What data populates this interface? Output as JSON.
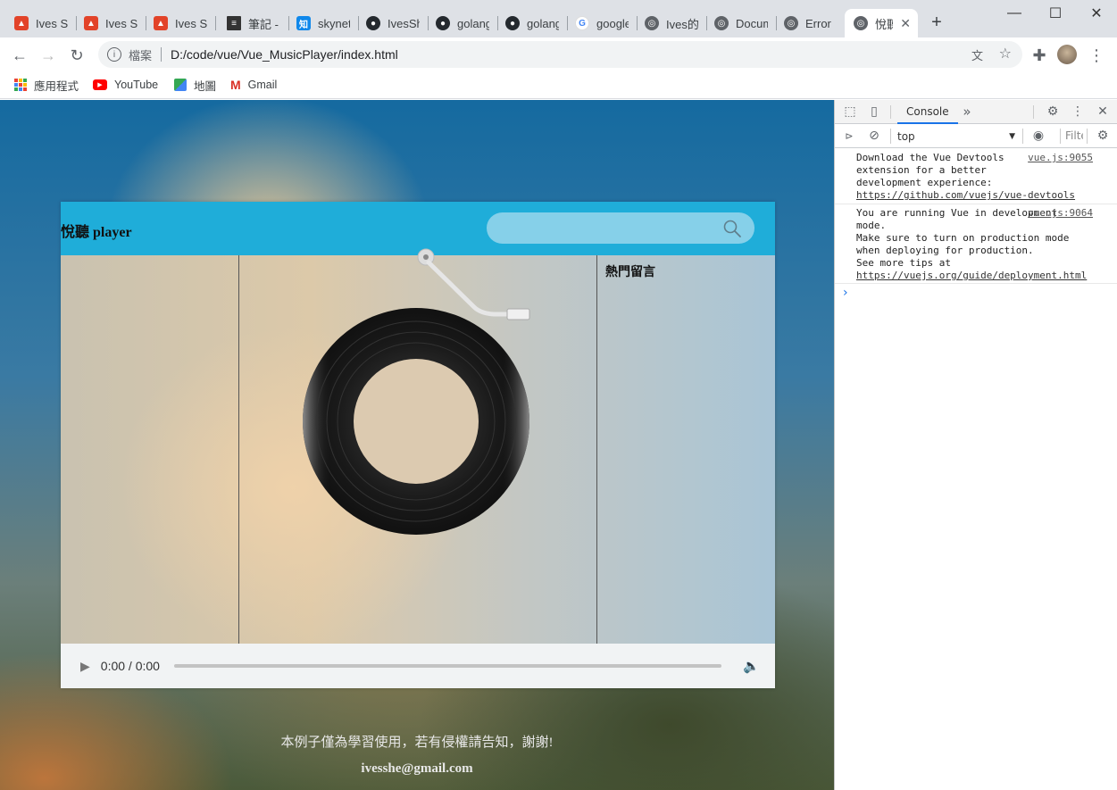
{
  "browser": {
    "tabs": [
      {
        "title": "Ives Sh",
        "icon": "gitlab-icon"
      },
      {
        "title": "Ives Sh",
        "icon": "gitlab-icon"
      },
      {
        "title": "Ives Sh",
        "icon": "gitlab-icon"
      },
      {
        "title": "筆記 - I",
        "icon": "document-icon"
      },
      {
        "title": "skynet",
        "icon": "zhihu-icon"
      },
      {
        "title": "IvesSh",
        "icon": "github-icon"
      },
      {
        "title": "golang",
        "icon": "github-icon"
      },
      {
        "title": "golang",
        "icon": "github-icon"
      },
      {
        "title": "google",
        "icon": "google-icon"
      },
      {
        "title": "Ives的",
        "icon": "globe-icon"
      },
      {
        "title": "Docum",
        "icon": "globe-icon"
      },
      {
        "title": "Error",
        "icon": "globe-icon"
      },
      {
        "title": "悅聽",
        "icon": "globe-icon"
      }
    ],
    "address": {
      "scheme_label": "檔案",
      "url": "D:/code/vue/Vue_MusicPlayer/index.html"
    },
    "bookmarks": [
      {
        "label": "應用程式",
        "icon": "apps-grid-icon"
      },
      {
        "label": "YouTube",
        "icon": "youtube-icon"
      },
      {
        "label": "地圖",
        "icon": "maps-icon"
      },
      {
        "label": "Gmail",
        "icon": "gmail-icon"
      }
    ]
  },
  "page": {
    "title": "悅聽 player",
    "search_value": "",
    "comments_heading": "熱門留言",
    "audio_time": "0:00 / 0:00",
    "footer_notice": "本例子僅為學習使用，若有侵權請告知，謝謝!",
    "footer_email": "ivesshe@gmail.com"
  },
  "devtools": {
    "tab": "Console",
    "context": "top",
    "filter_placeholder": "Filter",
    "messages": [
      {
        "source": "vue.js:9055",
        "text": "Download the Vue Devtools extension for a better development experience:",
        "link": "https://github.com/vuejs/vue-devtools"
      },
      {
        "source": "vue.js:9064",
        "text": "You are running Vue in development mode.\nMake sure to turn on production mode when deploying for production.\nSee more tips at",
        "link": "https://vuejs.org/guide/deployment.html"
      }
    ],
    "prompt": "›"
  },
  "colors": {
    "header_accent": "#1fadd9",
    "search_bg": "#86d0e9"
  }
}
